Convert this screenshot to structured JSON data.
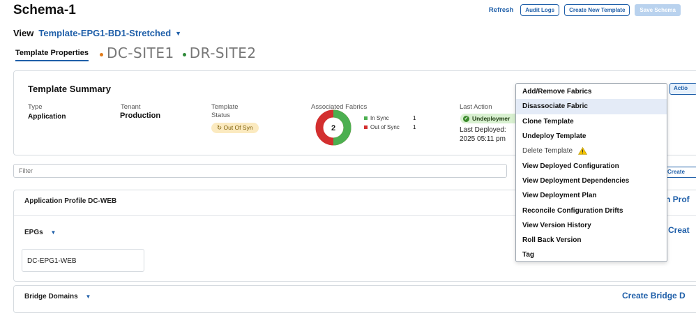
{
  "page": {
    "title": "Schema-1"
  },
  "top_actions": {
    "refresh": "Refresh",
    "audit_logs": "Audit Logs",
    "create_new_template": "Create New Template",
    "save_schema": "Save Schema"
  },
  "view": {
    "label": "View",
    "template": "Template-EPG1-BD1-Stretched"
  },
  "tabs": {
    "active": "Template Properties",
    "sites": [
      {
        "label": "DC-SITE1",
        "dot_color": "#e07b1a"
      },
      {
        "label": "DR-SITE2",
        "dot_color": "#2f8a3a"
      }
    ]
  },
  "summary": {
    "title": "Template Summary",
    "type_label": "Type",
    "type_value": "Application",
    "tenant_label": "Tenant",
    "tenant_value": "Production",
    "status_label_1": "Template",
    "status_label_2": "Status",
    "status_value": "Out Of Syn",
    "fabrics_label": "Associated Fabrics",
    "fabrics_total": "2",
    "in_sync_label": "In Sync",
    "in_sync_count": "1",
    "out_of_sync_label": "Out of Sync",
    "out_of_sync_count": "1",
    "in_sync_color": "#4caf50",
    "out_of_sync_color": "#d32f2f",
    "last_action_label": "Last Action",
    "last_action_value": "Undeploymer",
    "last_deployed_1": "Last Deployed:",
    "last_deployed_2": "2025 05:11 pm"
  },
  "filter": {
    "placeholder": "Filter"
  },
  "create_button_right": "Create",
  "app_profile": {
    "title": "Application Profile DC-WEB",
    "right_link": "n Prof",
    "epgs_label": "EPGs",
    "epg_create": "Creat",
    "epg_item": "DC-EPG1-WEB"
  },
  "bridge_domains": {
    "label": "Bridge Domains",
    "create": "Create Bridge D"
  },
  "actions_button": "Actio",
  "menu": {
    "items": [
      {
        "label": "Add/Remove Fabrics"
      },
      {
        "label": "Disassociate Fabric"
      },
      {
        "label": "Clone Template"
      },
      {
        "label": "Undeploy Template"
      },
      {
        "label": "Delete Template"
      },
      {
        "label": "View Deployed Configuration"
      },
      {
        "label": "View Deployment Dependencies"
      },
      {
        "label": "View Deployment Plan"
      },
      {
        "label": "Reconcile Configuration Drifts"
      },
      {
        "label": "View Version History"
      },
      {
        "label": "Roll Back Version"
      },
      {
        "label": "Tag"
      }
    ],
    "highlighted_index": 1,
    "disabled_index": 4
  },
  "icons": {
    "chevron": "chevron-down-icon",
    "warning": "warning-icon",
    "check": "check-circle-icon",
    "sync": "sync-icon"
  }
}
